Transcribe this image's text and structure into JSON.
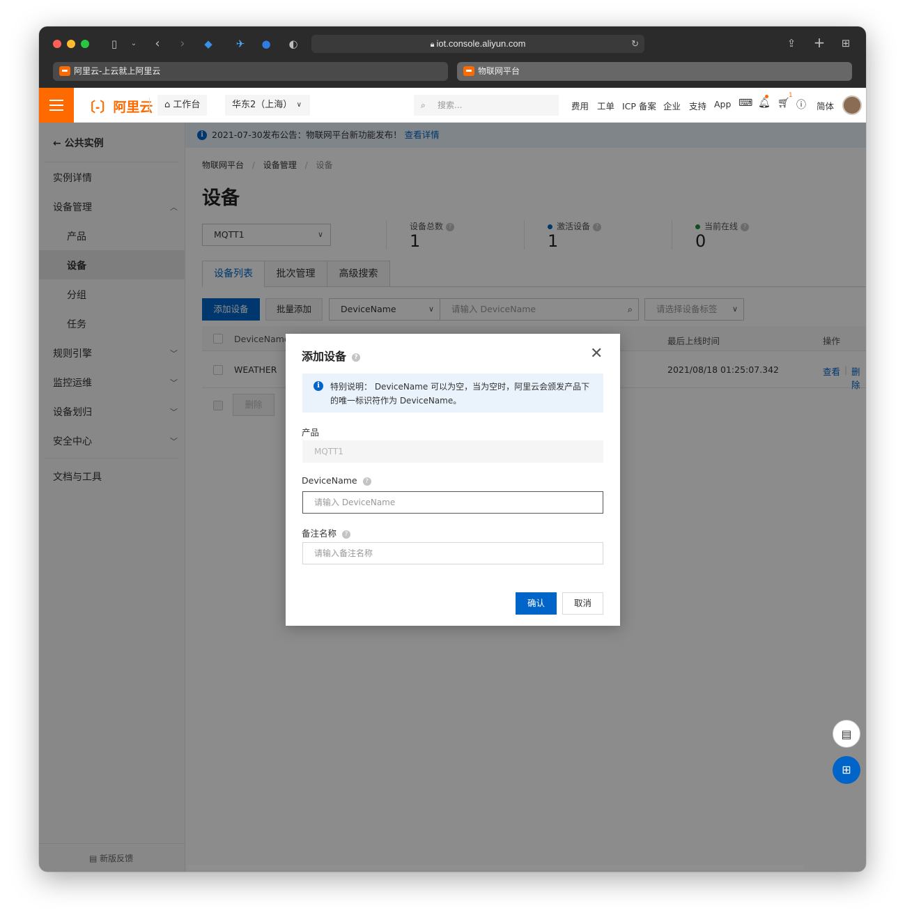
{
  "browser": {
    "url": "iot.console.aliyun.com",
    "tabs": [
      {
        "title": "阿里云-上云就上阿里云"
      },
      {
        "title": "物联网平台"
      }
    ]
  },
  "topbar": {
    "logo": "阿里云",
    "workbench": "工作台",
    "region": "华东2（上海）",
    "search_placeholder": "搜索...",
    "links": [
      "费用",
      "工单",
      "ICP 备案",
      "企业",
      "支持",
      "App"
    ],
    "cart_badge": "1",
    "lang": "简体"
  },
  "sidebar": {
    "back_label": "公共实例",
    "items": [
      {
        "label": "实例详情"
      },
      {
        "label": "设备管理"
      },
      {
        "label": "产品"
      },
      {
        "label": "设备"
      },
      {
        "label": "分组"
      },
      {
        "label": "任务"
      },
      {
        "label": "规则引擎"
      },
      {
        "label": "监控运维"
      },
      {
        "label": "设备划归"
      },
      {
        "label": "安全中心"
      },
      {
        "label": "文档与工具"
      }
    ],
    "feedback": "新版反馈"
  },
  "main": {
    "notice_text": "2021-07-30发布公告：物联网平台新功能发布！",
    "notice_link": "查看详情",
    "breadcrumb": [
      "物联网平台",
      "设备管理",
      "设备"
    ],
    "page_title": "设备",
    "product_select": "MQTT1",
    "stats": [
      {
        "label": "设备总数",
        "value": "1"
      },
      {
        "label": "激活设备",
        "value": "1"
      },
      {
        "label": "当前在线",
        "value": "0"
      }
    ],
    "tabs": [
      "设备列表",
      "批次管理",
      "高级搜索"
    ],
    "toolbar": {
      "add_button": "添加设备",
      "batch_button": "批量添加",
      "filter_field": "DeviceName",
      "search_placeholder": "请输入 DeviceName",
      "tag_placeholder": "请选择设备标签"
    },
    "table": {
      "headers": [
        "DeviceName/",
        "最后上线时间",
        "操作"
      ],
      "rows": [
        {
          "name": "WEATHER",
          "last_online": "2021/08/18 01:25:07.342",
          "action_view": "查看",
          "action_delete": "删除"
        }
      ],
      "footer_delete": "删除"
    }
  },
  "modal": {
    "title": "添加设备",
    "alert": "特别说明： DeviceName 可以为空，当为空时，阿里云会颁发产品下的唯一标识符作为 DeviceName。",
    "product_label": "产品",
    "product_value": "MQTT1",
    "devicename_label": "DeviceName",
    "devicename_placeholder": "请输入 DeviceName",
    "nickname_label": "备注名称",
    "nickname_placeholder": "请输入备注名称",
    "confirm": "确认",
    "cancel": "取消"
  },
  "colors": {
    "brand": "#ff6a00",
    "primary": "#0064c8",
    "notice_bg": "#eaf2fb"
  }
}
